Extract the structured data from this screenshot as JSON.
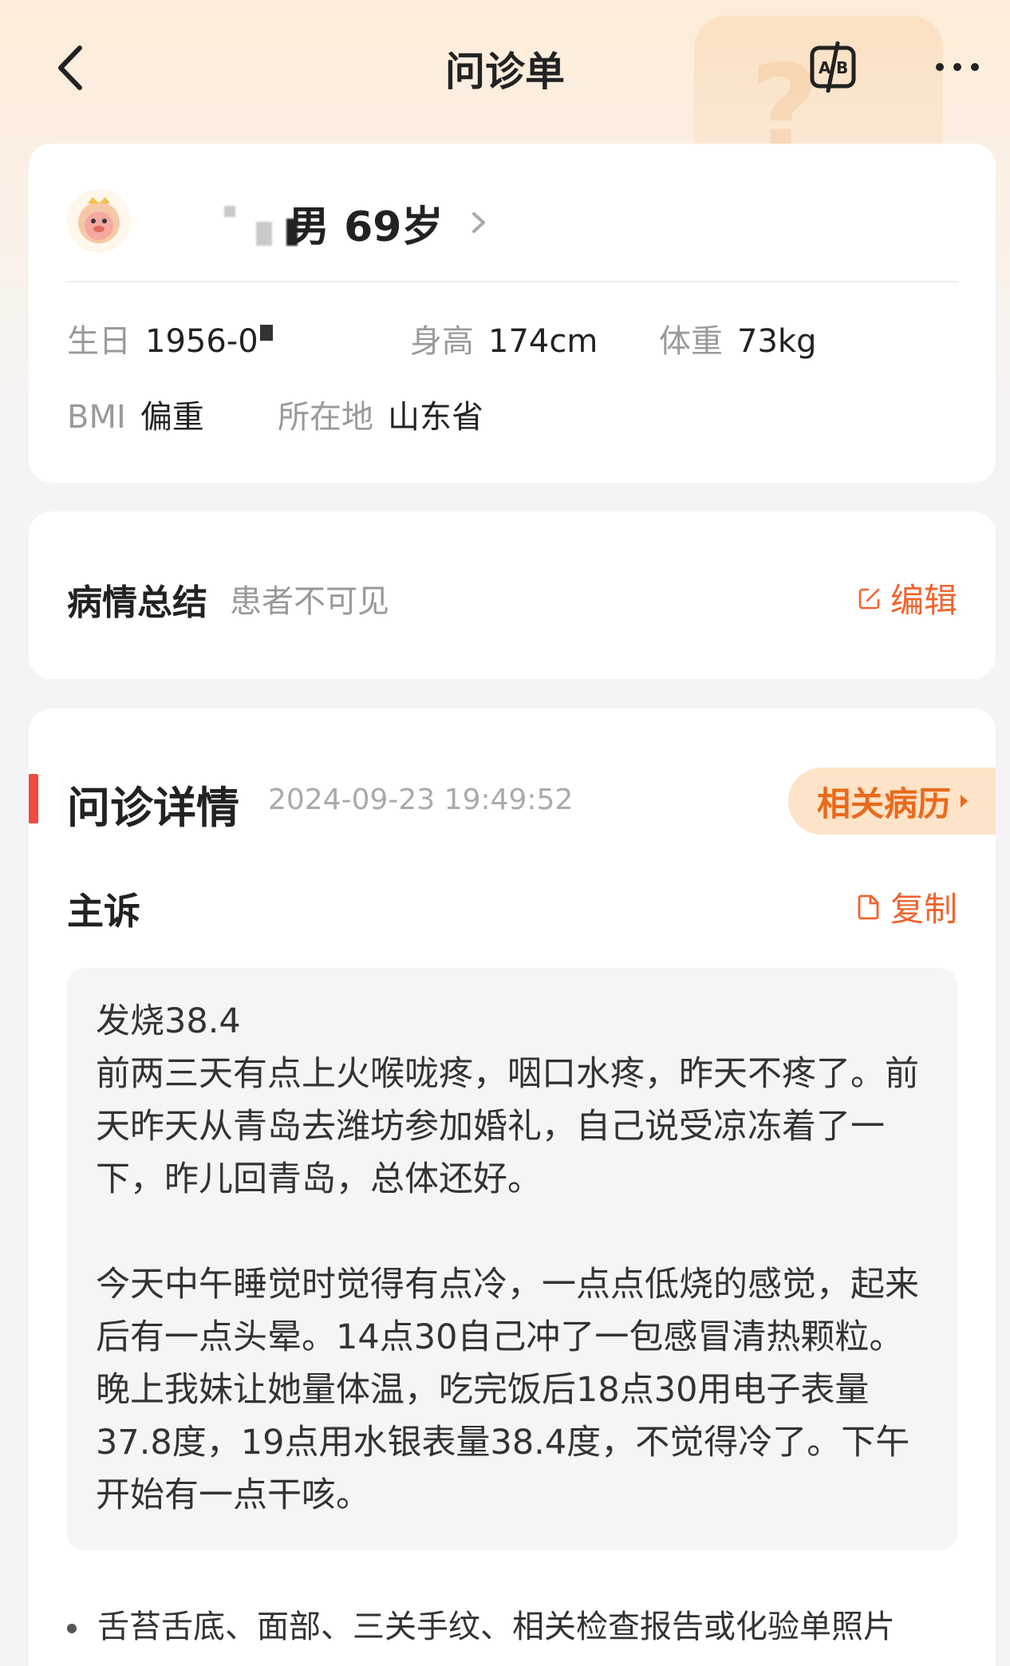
{
  "nav": {
    "title": "问诊单"
  },
  "patient": {
    "gender_age": "男 69岁",
    "birthday_label": "生日",
    "birthday_value": "1956-0",
    "height_label": "身高",
    "height_value": "174cm",
    "weight_label": "体重",
    "weight_value": "73kg",
    "bmi_label": "BMI",
    "bmi_value": "偏重",
    "location_label": "所在地",
    "location_value": "山东省"
  },
  "summary": {
    "title": "病情总结",
    "note": "患者不可见",
    "edit_label": "编辑"
  },
  "detail": {
    "title": "问诊详情",
    "time": "2024-09-23 19:49:52",
    "history_button": "相关病历",
    "complaint_title": "主诉",
    "copy_label": "复制",
    "complaint_text": "发烧38.4\n前两三天有点上火喉咙疼，咽口水疼，昨天不疼了。前天昨天从青岛去潍坊参加婚礼，自己说受凉冻着了一下，昨儿回青岛，总体还好。\n\n今天中午睡觉时觉得有点冷，一点点低烧的感觉，起来后有一点头晕。14点30自己冲了一包感冒清热颗粒。晚上我妹让她量体温，吃完饭后18点30用电子表量37.8度，19点用水银表量38.4度，不觉得冷了。下午开始有一点干咳。",
    "bullet_text": "舌苔舌底、面部、三关手纹、相关检查报告或化验单照片"
  },
  "colors": {
    "accent": "#f0642f",
    "accent_bar": "#ef4c3f",
    "history_bg": "#fde3c7"
  }
}
